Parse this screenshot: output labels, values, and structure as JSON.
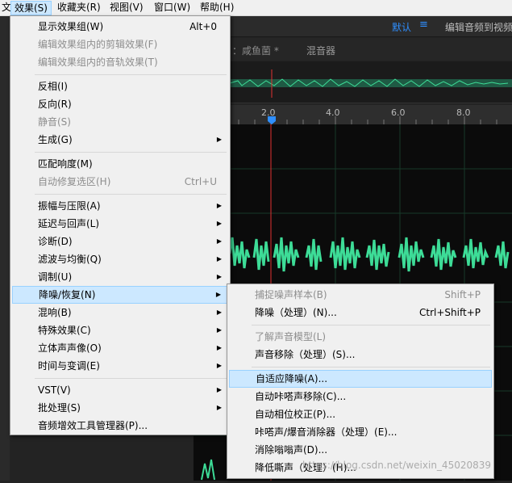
{
  "menubar": {
    "items": [
      "文件(F)",
      "效果(S)",
      "收藏夹(R)",
      "视图(V)",
      "窗口(W)",
      "帮助(H)"
    ],
    "active_index": 1
  },
  "workspace": {
    "default_label": "默认",
    "menu_icon": "hamburger-icon",
    "edit_label": "编辑音频到视频"
  },
  "editor": {
    "file_tab": "：咸鱼菌 *",
    "mixer_tab": "混音器",
    "ruler_ticks": [
      "2.0",
      "4.0",
      "6.0",
      "8.0"
    ]
  },
  "effects_menu": {
    "items": [
      {
        "label": "显示效果组(W)",
        "shortcut": "Alt+0",
        "disabled": false,
        "submenu": false
      },
      {
        "label": "编辑效果组内的剪辑效果(F)",
        "shortcut": "",
        "disabled": true,
        "submenu": false
      },
      {
        "label": "编辑效果组内的音轨效果(T)",
        "shortcut": "",
        "disabled": true,
        "submenu": false
      },
      {
        "label": "反相(I)",
        "shortcut": "",
        "disabled": false,
        "submenu": false
      },
      {
        "label": "反向(R)",
        "shortcut": "",
        "disabled": false,
        "submenu": false
      },
      {
        "label": "静音(S)",
        "shortcut": "",
        "disabled": true,
        "submenu": false
      },
      {
        "label": "生成(G)",
        "shortcut": "",
        "disabled": false,
        "submenu": true
      },
      {
        "label": "匹配响度(M)",
        "shortcut": "",
        "disabled": false,
        "submenu": false
      },
      {
        "label": "自动修复选区(H)",
        "shortcut": "Ctrl+U",
        "disabled": true,
        "submenu": false
      },
      {
        "label": "振幅与压限(A)",
        "shortcut": "",
        "disabled": false,
        "submenu": true
      },
      {
        "label": "延迟与回声(L)",
        "shortcut": "",
        "disabled": false,
        "submenu": true
      },
      {
        "label": "诊断(D)",
        "shortcut": "",
        "disabled": false,
        "submenu": true
      },
      {
        "label": "滤波与均衡(Q)",
        "shortcut": "",
        "disabled": false,
        "submenu": true
      },
      {
        "label": "调制(U)",
        "shortcut": "",
        "disabled": false,
        "submenu": true
      },
      {
        "label": "降噪/恢复(N)",
        "shortcut": "",
        "disabled": false,
        "submenu": true
      },
      {
        "label": "混响(B)",
        "shortcut": "",
        "disabled": false,
        "submenu": true
      },
      {
        "label": "特殊效果(C)",
        "shortcut": "",
        "disabled": false,
        "submenu": true
      },
      {
        "label": "立体声声像(O)",
        "shortcut": "",
        "disabled": false,
        "submenu": true
      },
      {
        "label": "时间与变调(E)",
        "shortcut": "",
        "disabled": false,
        "submenu": true
      },
      {
        "label": "VST(V)",
        "shortcut": "",
        "disabled": false,
        "submenu": true
      },
      {
        "label": "批处理(S)",
        "shortcut": "",
        "disabled": false,
        "submenu": true
      },
      {
        "label": "音频增效工具管理器(P)...",
        "shortcut": "",
        "disabled": false,
        "submenu": false
      }
    ]
  },
  "noise_submenu": {
    "items": [
      {
        "label": "捕捉噪声样本(B)",
        "shortcut": "Shift+P",
        "disabled": true
      },
      {
        "label": "降噪（处理）(N)...",
        "shortcut": "Ctrl+Shift+P",
        "disabled": false
      },
      {
        "label": "了解声音模型(L)",
        "shortcut": "",
        "disabled": true
      },
      {
        "label": "声音移除（处理）(S)...",
        "shortcut": "",
        "disabled": false
      },
      {
        "label": "自适应降噪(A)...",
        "shortcut": "",
        "disabled": false
      },
      {
        "label": "自动咔嗒声移除(C)...",
        "shortcut": "",
        "disabled": false
      },
      {
        "label": "自动相位校正(P)...",
        "shortcut": "",
        "disabled": false
      },
      {
        "label": "咔嗒声/爆音消除器（处理）(E)...",
        "shortcut": "",
        "disabled": false
      },
      {
        "label": "消除嗡嗡声(D)...",
        "shortcut": "",
        "disabled": false
      },
      {
        "label": "降低嘶声（处理）(H)...",
        "shortcut": "",
        "disabled": false
      }
    ]
  },
  "watermark": "https://blog.csdn.net/weixin_45020839",
  "colors": {
    "waveform": "#3ddc97",
    "playhead": "#e03030",
    "accent": "#2f8fff"
  }
}
